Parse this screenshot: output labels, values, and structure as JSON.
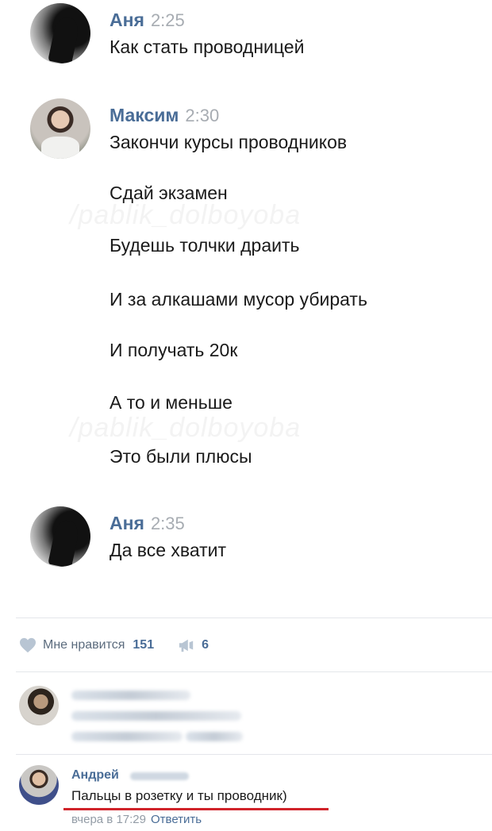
{
  "chat": {
    "messages": [
      {
        "author": "Аня",
        "time": "2:25",
        "lines": [
          "Как стать проводницей"
        ]
      },
      {
        "author": "Максим",
        "time": "2:30",
        "lines": [
          "Закончи курсы проводников",
          "Сдай экзамен",
          "Будешь толчки драить",
          "И за алкашами мусор убирать",
          "И получать 20к",
          "А то и меньше",
          "Это были плюсы"
        ]
      },
      {
        "author": "Аня",
        "time": "2:35",
        "lines": [
          "Да все хватит"
        ]
      }
    ],
    "watermark": "/pablik_dolboyoba"
  },
  "post_actions": {
    "like_label": "Мне нравится",
    "like_count": "151",
    "share_count": "6",
    "like_icon": "heart-icon",
    "share_icon": "megaphone-icon"
  },
  "comments": [
    {
      "author": "Андрей",
      "text": "Пальцы в розетку и ты проводник)",
      "date": "вчера в 17:29",
      "reply_label": "Ответить"
    }
  ],
  "colors": {
    "link": "#4a6d97",
    "time": "#a7acb2",
    "underline": "#d0232a"
  }
}
